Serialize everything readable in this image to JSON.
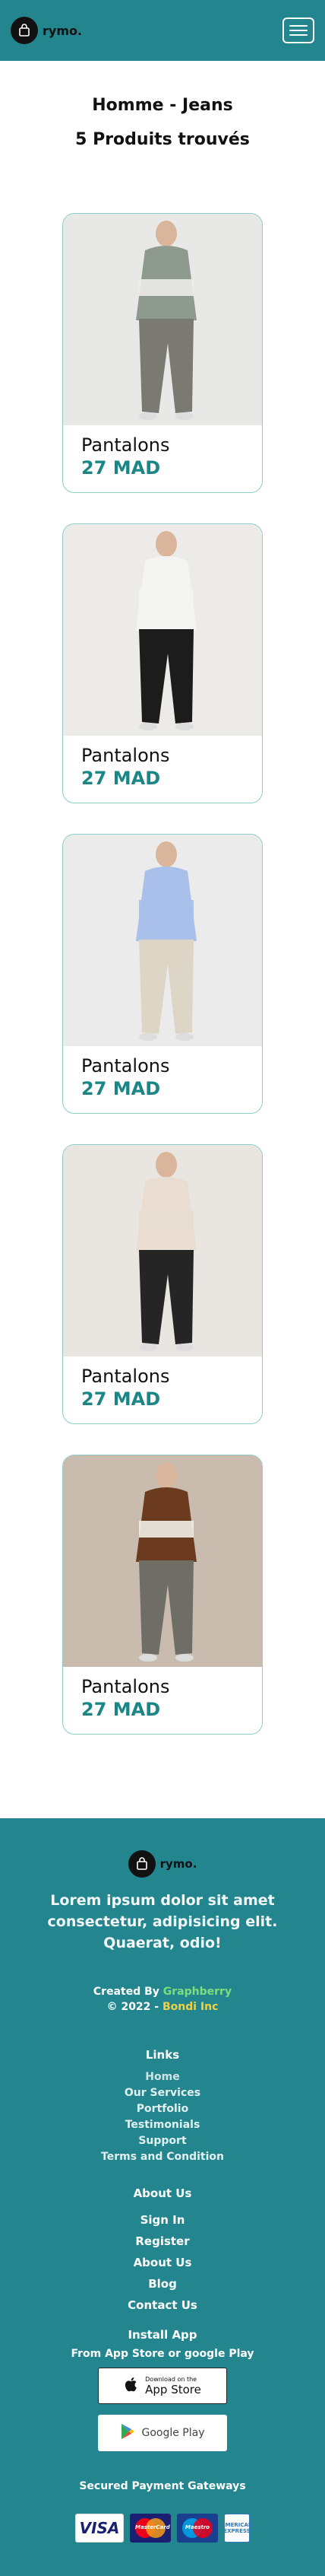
{
  "header": {
    "brand": "rymo.",
    "menu_icon": "hamburger-menu-icon"
  },
  "listing": {
    "category_title": "Homme - Jeans",
    "results_count": "5 Produits trouvés"
  },
  "products": [
    {
      "name": "Pantalons",
      "price": "27 MAD",
      "top_color": "#8f9a8f",
      "top_band": "#ecece8",
      "bottom_color": "#7a7a72",
      "bg": "#e8e8e6"
    },
    {
      "name": "Pantalons",
      "price": "27 MAD",
      "top_color": "#f4f4f2",
      "top_band": "#f4f4f2",
      "bottom_color": "#1c1c1c",
      "bg": "#ecebe7"
    },
    {
      "name": "Pantalons",
      "price": "27 MAD",
      "top_color": "#a9c0ea",
      "top_band": "#a9c0ea",
      "bottom_color": "#ddd5c6",
      "bg": "#ebebeb"
    },
    {
      "name": "Pantalons",
      "price": "27 MAD",
      "top_color": "#e8ddd0",
      "top_band": "#e8ddd0",
      "bottom_color": "#252525",
      "bg": "#e9e6e1"
    },
    {
      "name": "Pantalons",
      "price": "27 MAD",
      "top_color": "#6b3a1f",
      "top_band": "#f2efe8",
      "bottom_color": "#6e6e66",
      "bg": "#c9bcaf"
    }
  ],
  "footer": {
    "brand": "rymo.",
    "tagline": "Lorem ipsum dolor sit amet consectetur, adipisicing elit. Quaerat, odio!",
    "created_prefix": "Created By ",
    "created_by": "Graphberry",
    "copyright_prefix": "© 2022 - ",
    "copyright_owner": "Bondi Inc",
    "links_heading": "Links",
    "links": [
      "Home",
      "Our Services",
      "Portfolio",
      "Testimonials",
      "Support",
      "Terms and Condition"
    ],
    "about_heading": "About Us",
    "about_links": [
      "Sign In",
      "Register",
      "About Us",
      "Blog",
      "Contact Us"
    ],
    "install_title": "Install App",
    "install_subtitle": "From App Store or google Play",
    "app_store_small": "Download on the",
    "app_store_big": "App Store",
    "google_play_label": "Google Play",
    "payment_title": "Secured Payment Gateways",
    "payment_methods": [
      "VISA",
      "MasterCard",
      "Maestro",
      "AMERICAN EXPRESS"
    ]
  }
}
